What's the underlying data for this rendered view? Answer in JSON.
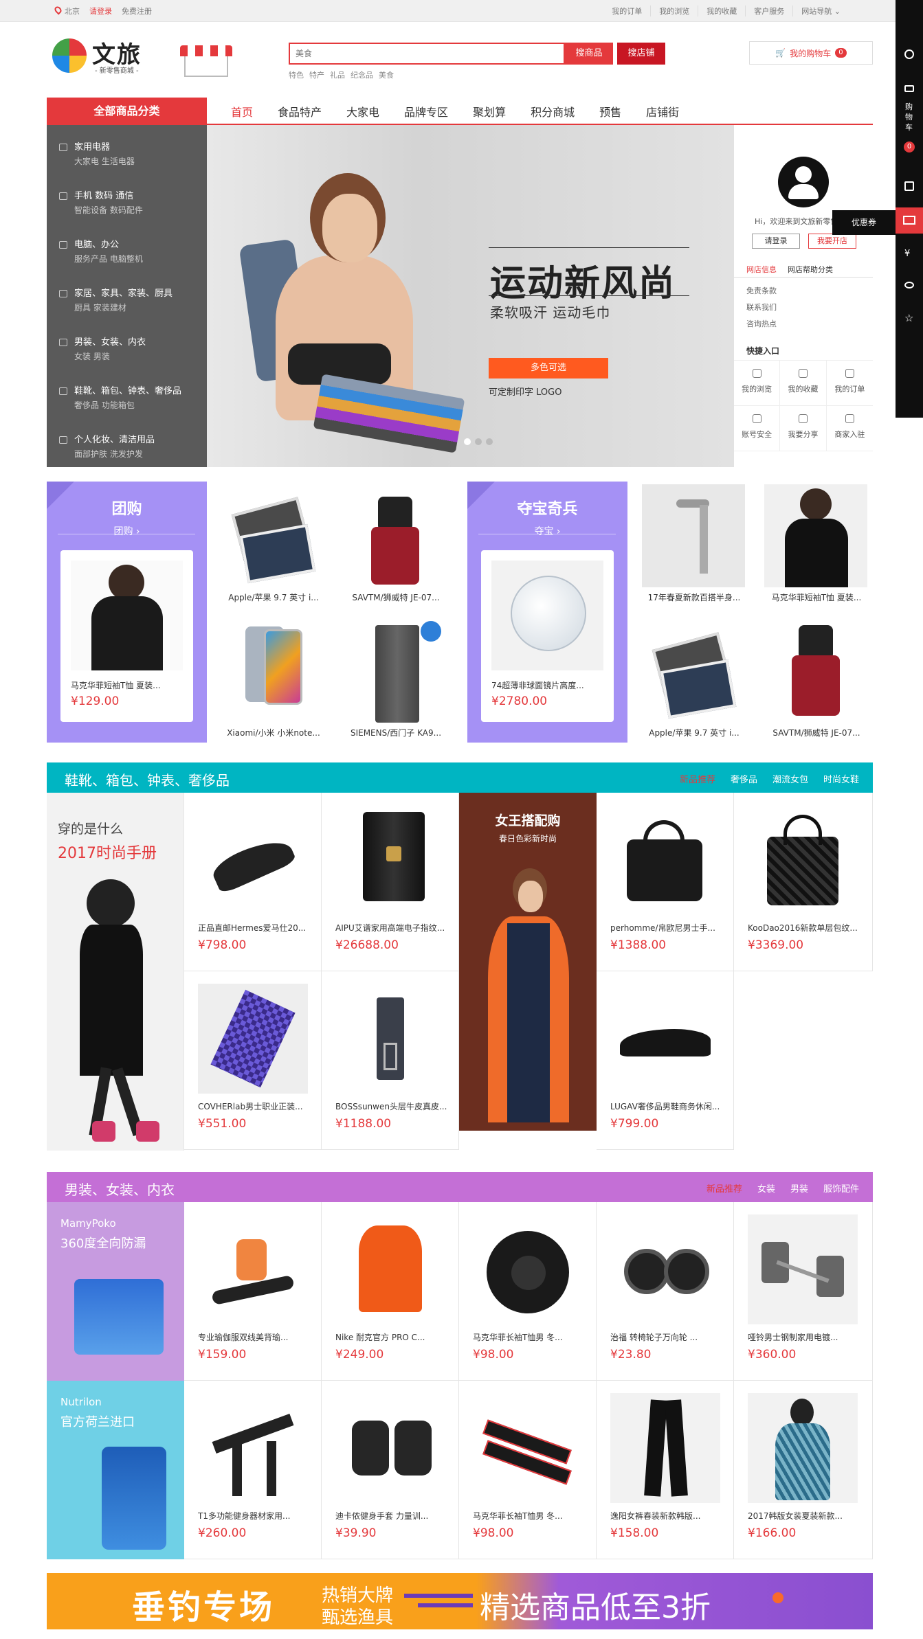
{
  "topbar": {
    "location": "北京",
    "login": "请登录",
    "register": "免费注册",
    "links": [
      "我的订单",
      "我的浏览",
      "我的收藏",
      "客户服务",
      "网站导航"
    ]
  },
  "header": {
    "logo_text": "文旅",
    "logo_sub": "- 新零售商城 -",
    "search_placeholder": "美食",
    "search_btn": "搜商品",
    "shop_btn": "搜店铺",
    "hot_words": [
      "特色",
      "特产",
      "礼品",
      "纪念品",
      "美食"
    ],
    "cart_label": "我的购物车",
    "cart_count": "0"
  },
  "nav": {
    "all_categories": "全部商品分类",
    "items": [
      "首页",
      "食品特产",
      "大家电",
      "品牌专区",
      "聚划算",
      "积分商城",
      "预售",
      "店铺街"
    ]
  },
  "categories": [
    {
      "title": "家用电器",
      "sub": "大家电  生活电器"
    },
    {
      "title": "手机  数码  通信",
      "sub": "智能设备  数码配件"
    },
    {
      "title": "电脑、办公",
      "sub": "服务产品  电脑整机"
    },
    {
      "title": "家居、家具、家装、厨具",
      "sub": "厨具  家装建材"
    },
    {
      "title": "男装、女装、内衣",
      "sub": "女装  男装"
    },
    {
      "title": "鞋靴、箱包、钟表、奢侈品",
      "sub": "奢侈品  功能箱包"
    },
    {
      "title": "个人化妆、清洁用品",
      "sub": "面部护肤  洗发护发"
    }
  ],
  "banner": {
    "title": "运动新风尚",
    "subtitle": "柔软吸汗 运动毛巾",
    "button": "多色可选",
    "note": "可定制印字 LOGO"
  },
  "user_panel": {
    "greeting": "Hi，欢迎来到文旅新零售",
    "login_btn": "请登录",
    "open_shop_btn": "我要开店",
    "tab_news": "网店信息",
    "tab_help": "网店帮助分类",
    "notes": [
      "免责条款",
      "联系我们",
      "咨询热点"
    ],
    "quick_title": "快捷入口",
    "quick_links": [
      "我的浏览",
      "我的收藏",
      "我的订单",
      "账号安全",
      "我要分享",
      "商家入驻"
    ]
  },
  "right_bar": {
    "cart_text": "购物车",
    "cart_count": "0",
    "coupon": "优惠券"
  },
  "group_buy": {
    "title": "团购",
    "subtitle": "团购",
    "card_name": "马克华菲短袖T恤 夏装...",
    "card_price": "¥129.00",
    "products": [
      {
        "name": "Apple/苹果 9.7 英寸 i..."
      },
      {
        "name": "SAVTM/狮威特 JE-07..."
      },
      {
        "name": "Xiaomi/小米 小米note..."
      },
      {
        "name": "SIEMENS/西门子 KA9..."
      }
    ]
  },
  "treasure": {
    "title": "夺宝奇兵",
    "subtitle": "夺宝",
    "card_name": "74超薄非球面镜片高度...",
    "card_price": "¥2780.00",
    "products": [
      {
        "name": "17年春夏新款百搭半身..."
      },
      {
        "name": "马克华菲短袖T恤 夏装..."
      },
      {
        "name": "Apple/苹果 9.7 英寸 i..."
      },
      {
        "name": "SAVTM/狮威特 JE-07..."
      }
    ]
  },
  "floor1": {
    "title": "鞋靴、箱包、钟表、奢侈品",
    "tabs": [
      "新品推荐",
      "奢侈品",
      "潮流女包",
      "时尚女鞋"
    ],
    "promo_line1": "穿的是什么",
    "promo_line2": "2017时尚手册",
    "feature_title": "女王搭配购",
    "feature_sub": "春日色彩新时尚",
    "products": [
      {
        "name": "正品直邮Hermes爱马仕20...",
        "price": "¥798.00"
      },
      {
        "name": "AIPU艾谱家用高端电子指纹...",
        "price": "¥26688.00"
      },
      {
        "name": "perhomme/帛欧尼男士手...",
        "price": "¥1388.00"
      },
      {
        "name": "KooDao2016新款单层包纹...",
        "price": "¥3369.00"
      },
      {
        "name": "COVHERlab男士职业正装...",
        "price": "¥551.00"
      },
      {
        "name": "BOSSsunwen头层牛皮真皮...",
        "price": "¥1188.00"
      },
      {
        "name": "LUGAV奢侈品男鞋商务休闲...",
        "price": "¥799.00"
      }
    ]
  },
  "floor2": {
    "title": "男装、女装、内衣",
    "tabs": [
      "新品推荐",
      "女装",
      "男装",
      "服饰配件"
    ],
    "promo1_line1": "MamyPoko",
    "promo1_line2": "360度全向防漏",
    "promo2_line1": "Nutrilon",
    "promo2_line2": "官方荷兰进口",
    "products": [
      {
        "name": "专业瑜伽服双线美背瑜...",
        "price": "¥159.00"
      },
      {
        "name": "Nike 耐克官方 PRO C...",
        "price": "¥249.00"
      },
      {
        "name": "马克华菲长袖T恤男 冬...",
        "price": "¥98.00"
      },
      {
        "name": "治福 转椅轮子万向轮 ...",
        "price": "¥23.80"
      },
      {
        "name": "哑铃男士钢制家用电镀...",
        "price": "¥360.00"
      },
      {
        "name": "T1多功能健身器材家用...",
        "price": "¥260.00"
      },
      {
        "name": "迪卡侬健身手套 力量训...",
        "price": "¥39.90"
      },
      {
        "name": "马克华菲长袖T恤男 冬...",
        "price": "¥98.00"
      },
      {
        "name": "逸阳女裤春装新款韩版...",
        "price": "¥158.00"
      },
      {
        "name": "2017韩版女装夏装新款...",
        "price": "¥166.00"
      }
    ]
  },
  "bottom_banner": {
    "title": "垂钓专场",
    "sub1": "热销大牌",
    "sub2": "甄选渔具",
    "slogan": "精选商品低至3折"
  },
  "colors": {
    "accent": "#e4393c",
    "floor1": "#00b5c2",
    "floor2": "#c46fd6",
    "group": "#a591f5"
  }
}
